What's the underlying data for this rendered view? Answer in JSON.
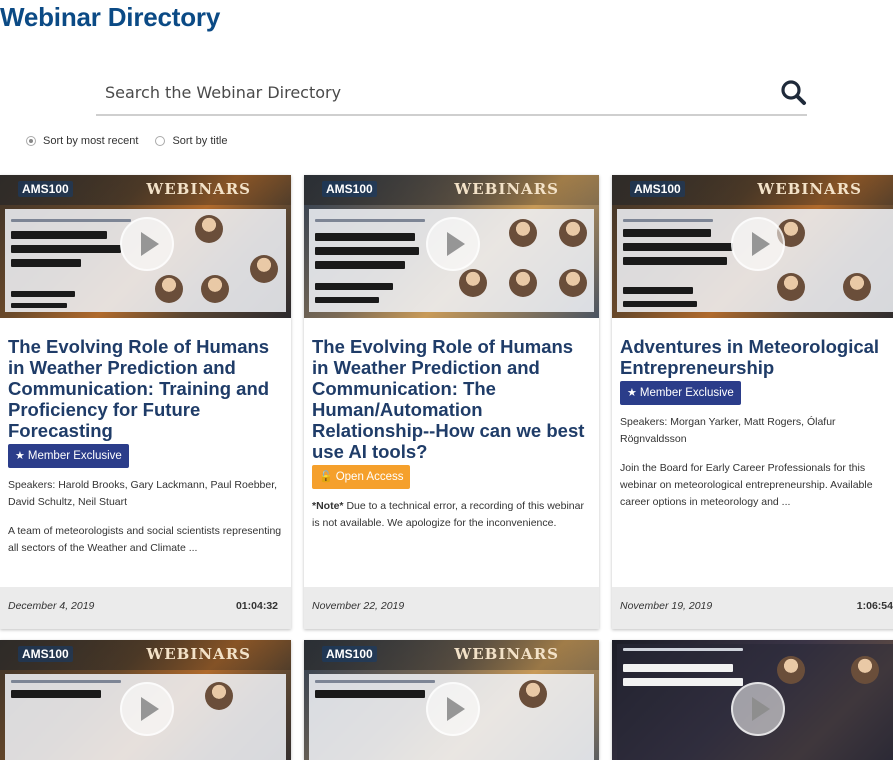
{
  "page": {
    "title": "Webinar Directory"
  },
  "search": {
    "placeholder": "Search the Webinar Directory",
    "icon": "search-icon"
  },
  "sort": {
    "options": [
      "Sort by most recent",
      "Sort by title"
    ],
    "selected": "Sort by most recent"
  },
  "thumb": {
    "logo": "AMS100",
    "banner": "WEBINARS"
  },
  "cards": [
    {
      "title": "The Evolving Role of Humans in Weather Prediction and Communication: Training and Proficiency for Future Forecasting",
      "badge": "Member Exclusive",
      "badge_type": "member",
      "speakers": "Speakers: Harold Brooks, Gary Lackmann, Paul Roebber, David Schultz, Neil Stuart",
      "description": "A team of meteorologists and social scientists representing all sectors of the Weather and Climate ...",
      "date": "December 4, 2019",
      "duration": "01:04:32"
    },
    {
      "title": "The Evolving Role of Humans in Weather Prediction and Communication: The Human/Automation Relationship--How can we best use AI tools?",
      "badge": "Open Access",
      "badge_type": "open",
      "note_label": "*Note*",
      "description": "Due to a technical error, a recording of this webinar is not available. We apologize for the inconvenience.",
      "date": "November 22, 2019",
      "duration": ""
    },
    {
      "title": "Adventures in Meteorological Entrepreneurship",
      "badge": "Member Exclusive",
      "badge_type": "member",
      "speakers": "Speakers: Morgan Yarker, Matt Rogers, Ólafur Rögnvaldsson",
      "description": "Join the Board for Early Career Professionals for this webinar on meteorological entrepreneurship. Available career options in meteorology and ...",
      "date": "November 19, 2019",
      "duration": "1:06:54"
    }
  ]
}
